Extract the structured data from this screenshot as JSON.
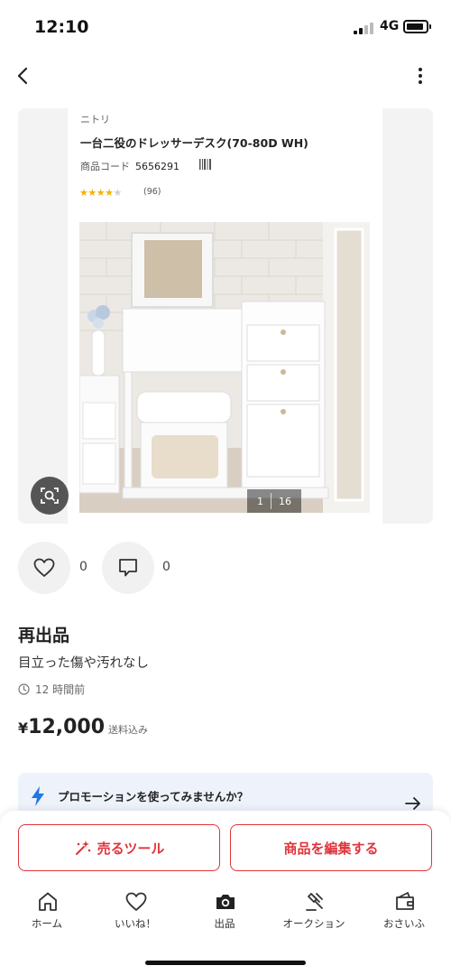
{
  "status_bar": {
    "time": "12:10",
    "network": "4G"
  },
  "product_card": {
    "brand": "ニトリ",
    "name": "一台二役のドレッサーデスク(70-80D WH)",
    "code_label": "商品コード",
    "code_value": "5656291",
    "rating": 4,
    "rating_max": 5,
    "review_count": "(96)",
    "photo_current": "1",
    "photo_total": "16"
  },
  "actions": {
    "likes": "0",
    "comments": "0"
  },
  "listing": {
    "title": "再出品",
    "description": "目立った傷や汚れなし",
    "posted": "12 時間前",
    "price_symbol": "¥",
    "price": "12,000",
    "shipping": "送料込み"
  },
  "promo": {
    "text": "プロモーションを使ってみませんか？"
  },
  "buttons": {
    "sell_tools": "売るツール",
    "edit": "商品を編集する"
  },
  "tabs": [
    {
      "label": "ホーム",
      "icon": "home-icon"
    },
    {
      "label": "いいね！",
      "icon": "heart-icon"
    },
    {
      "label": "出品",
      "icon": "camera-icon"
    },
    {
      "label": "オークション",
      "icon": "gavel-icon"
    },
    {
      "label": "おさいふ",
      "icon": "wallet-icon"
    }
  ],
  "colors": {
    "accent": "#e0343b",
    "promo_bg": "#eef3fb",
    "star": "#f2b400",
    "bolt": "#1e78e6"
  }
}
